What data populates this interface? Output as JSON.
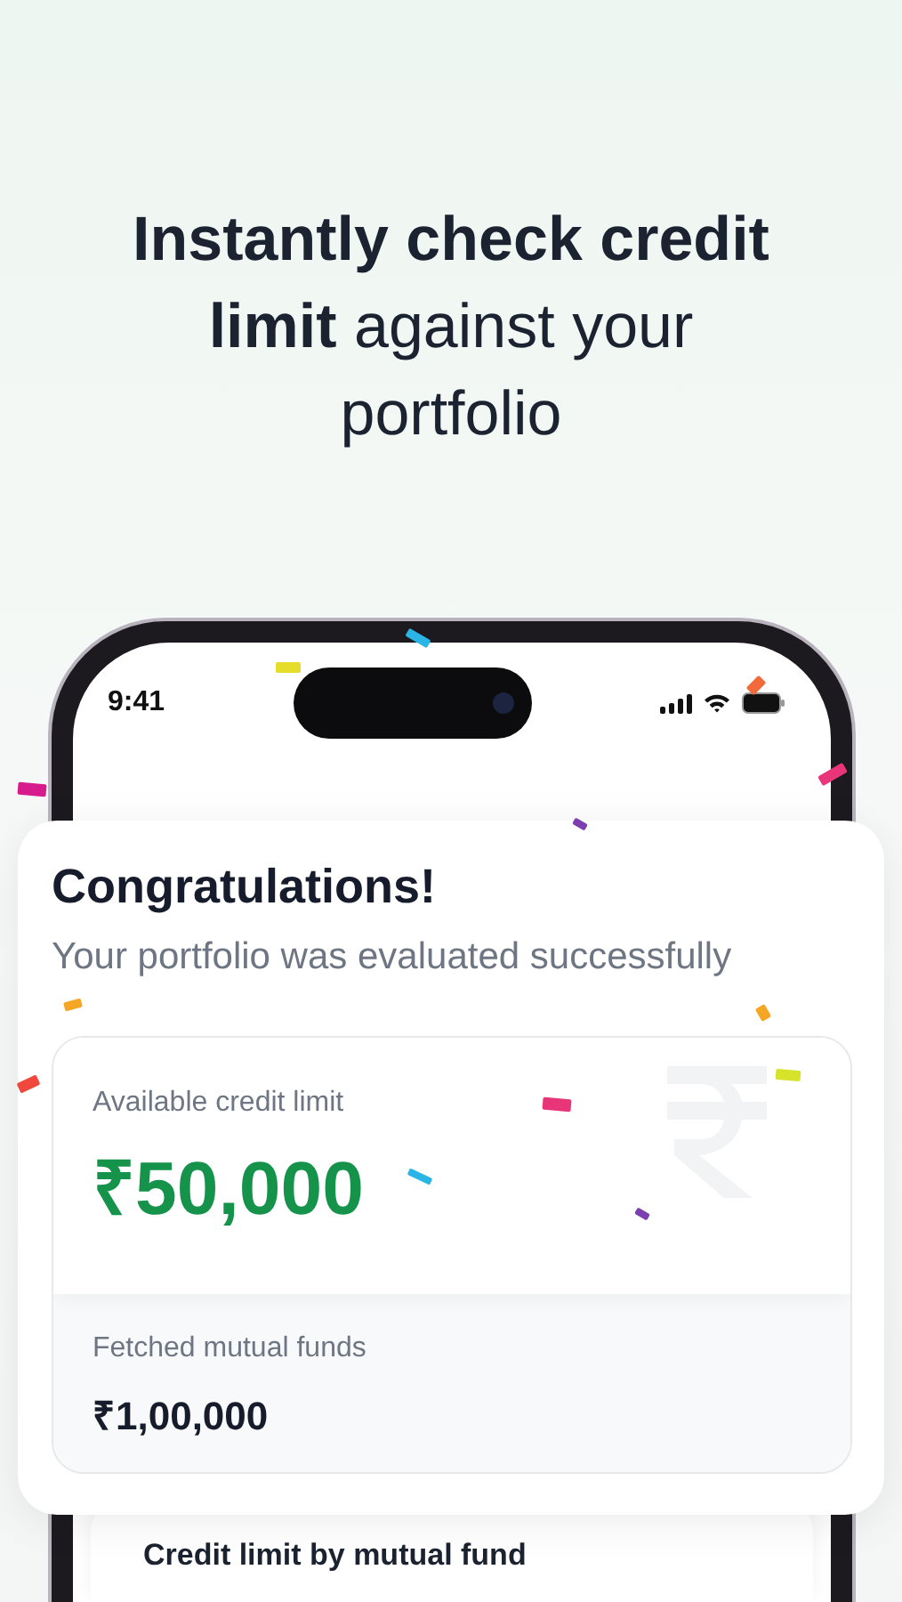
{
  "headline": "**Instantly check credit limit** against your portfolio",
  "status_bar": {
    "time": "9:41"
  },
  "result_card": {
    "title": "Congratulations!",
    "subtitle": "Your portfolio was evaluated successfully",
    "credit": {
      "label": "Available credit limit",
      "amount": "₹50,000"
    },
    "funds": {
      "label": "Fetched mutual funds",
      "amount": "₹1,00,000"
    }
  },
  "next_section": {
    "title": "Credit limit by mutual fund"
  }
}
